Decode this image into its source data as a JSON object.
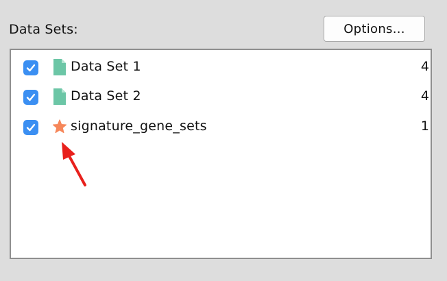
{
  "header": {
    "title": "Data Sets:",
    "options_label": "Options..."
  },
  "data_sets": [
    {
      "name": "Data Set 1",
      "count": "4",
      "checked": true,
      "icon": "document-icon",
      "icon_color": "#6cc6a6"
    },
    {
      "name": "Data Set 2",
      "count": "4",
      "checked": true,
      "icon": "document-icon",
      "icon_color": "#6cc6a6"
    },
    {
      "name": "signature_gene_sets",
      "count": "1",
      "checked": true,
      "icon": "star-icon",
      "icon_color": "#f6875a"
    }
  ],
  "colors": {
    "checkbox": "#3b8ff2",
    "annotation_arrow": "#e8201c"
  }
}
